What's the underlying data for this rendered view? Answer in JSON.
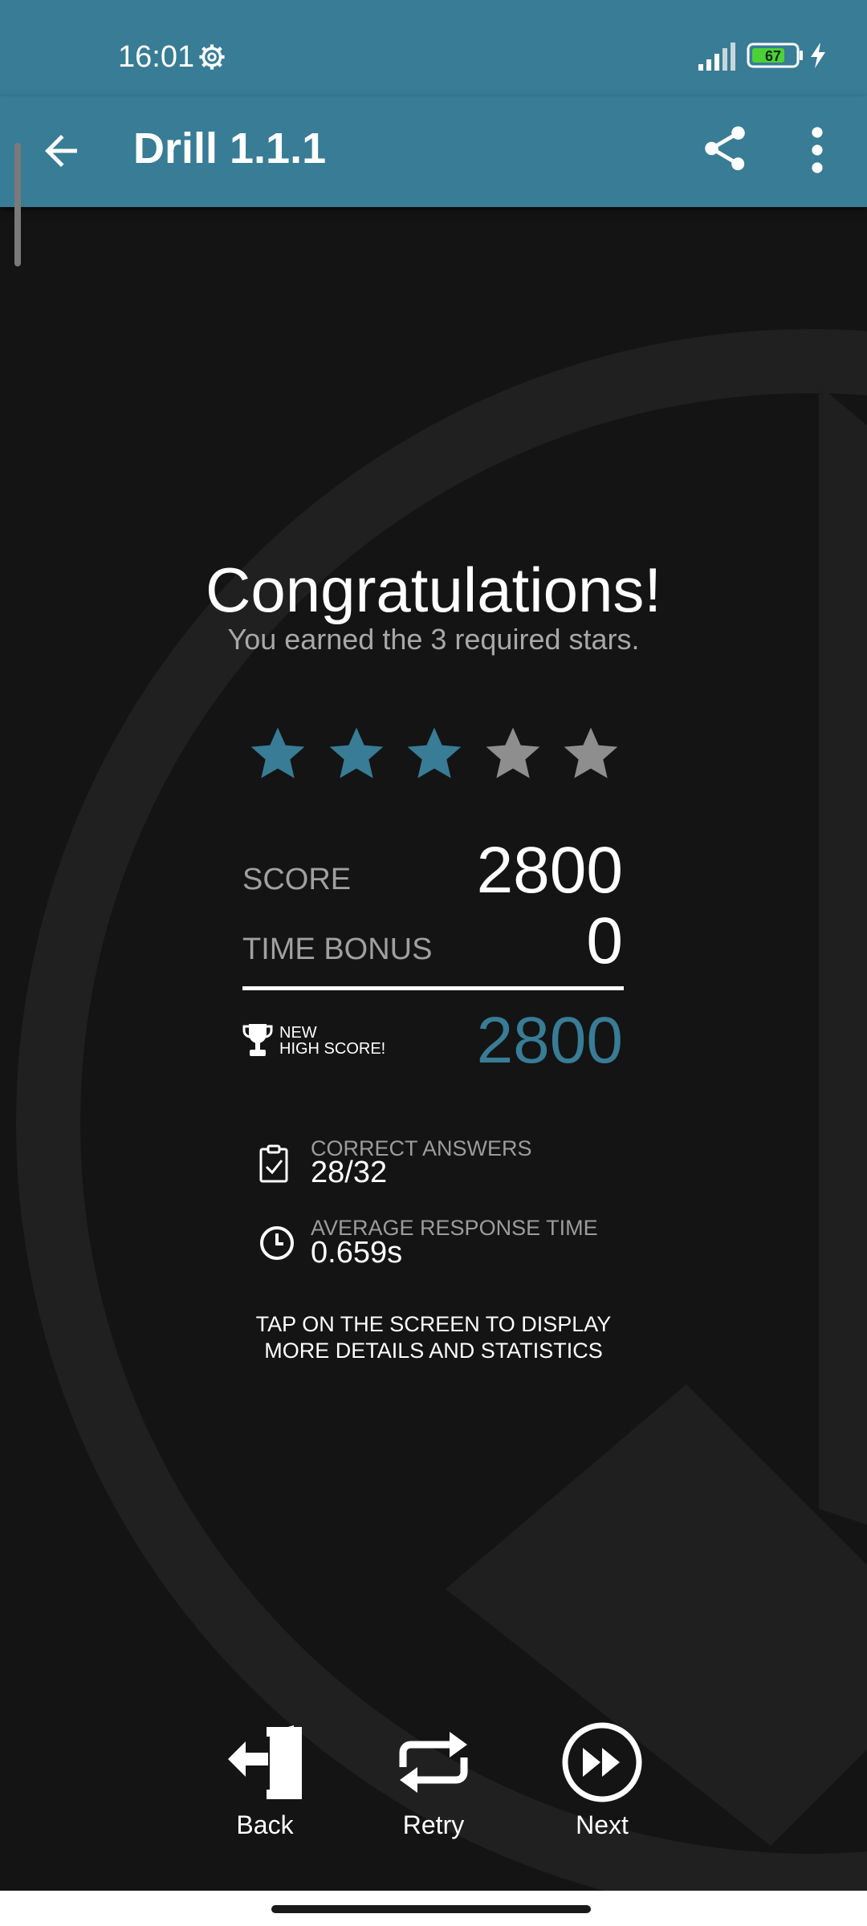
{
  "status_bar": {
    "time": "16:01",
    "battery": "67"
  },
  "app_bar": {
    "title": "Drill 1.1.1"
  },
  "result": {
    "title": "Congratulations!",
    "subtitle": "You earned the 3 required stars.",
    "stars": {
      "earned": 3,
      "total": 5
    },
    "score_label": "SCORE",
    "score_value": "2800",
    "time_bonus_label": "TIME BONUS",
    "time_bonus_value": "0",
    "new_label": "NEW",
    "high_score_label": "HIGH SCORE!",
    "high_score_value": "2800"
  },
  "stats": {
    "correct_label": "CORRECT ANSWERS",
    "correct_value": "28/32",
    "avg_label": "AVERAGE RESPONSE TIME",
    "avg_value": "0.659s"
  },
  "hint": {
    "line1": "TAP ON THE SCREEN TO DISPLAY",
    "line2": "MORE DETAILS AND STATISTICS"
  },
  "actions": {
    "back": "Back",
    "retry": "Retry",
    "next": "Next"
  },
  "colors": {
    "accent": "#387c96",
    "star_off": "#8e8e8e",
    "background": "#141414"
  },
  "icons": [
    "gear-icon",
    "signal-icon",
    "battery-icon",
    "charging-icon",
    "back-arrow-icon",
    "share-icon",
    "more-vert-icon",
    "star-icon",
    "trophy-icon",
    "clipboard-check-icon",
    "clock-icon",
    "exit-door-icon",
    "repeat-icon",
    "fast-forward-icon"
  ]
}
